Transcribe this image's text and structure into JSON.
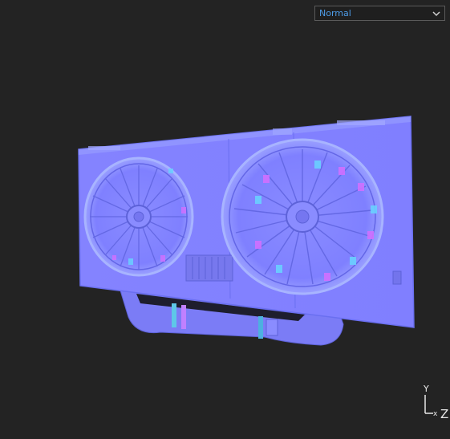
{
  "view_mode": {
    "selected": "Normal"
  },
  "axis_gizmo": {
    "y_label": "Y",
    "z_label": "Z"
  },
  "colors": {
    "background": "#232323",
    "dropdown_text": "#4d9be6",
    "normal_base": "#8080ff"
  }
}
